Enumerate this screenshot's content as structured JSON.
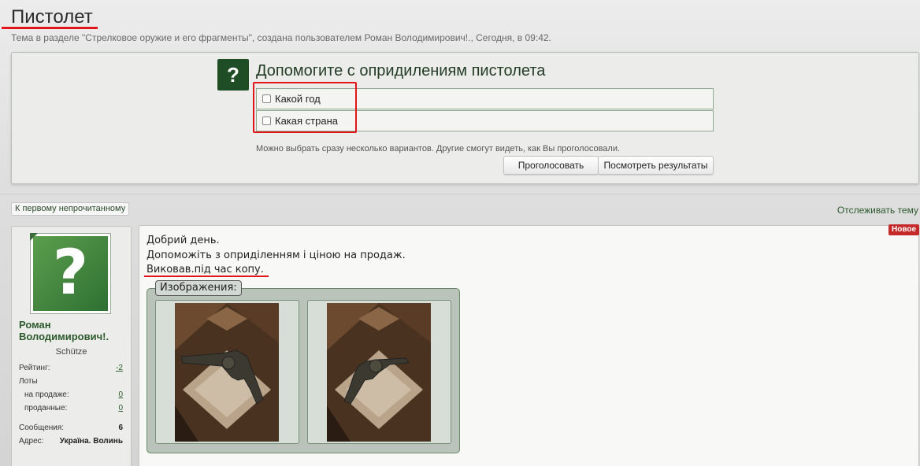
{
  "thread": {
    "title": "Пистолет",
    "meta": "Тема в разделе \"Стрелковое оружие и его фрагменты\", создана пользователем Роман Володимирович!., Сегодня, в 09:42."
  },
  "poll": {
    "question": "Допомогите с опридилениям пистолета",
    "options": [
      "Какой год",
      "Какая страна"
    ],
    "hint": "Можно выбрать сразу несколько вариантов. Другие смогут видеть, как Вы проголосовали.",
    "vote_label": "Проголосовать",
    "results_label": "Посмотреть результаты",
    "icon": "question-mark-icon"
  },
  "nav": {
    "first_unread": "К первому непрочитанному",
    "watch_thread": "Отслеживать тему"
  },
  "user": {
    "name": "Роман Володимирович!.",
    "title": "Schütze",
    "stats": {
      "rating_label": "Рейтинг:",
      "rating_value": "-2",
      "lots_label": "Лоты",
      "for_sale_label": "на продаже:",
      "for_sale_value": "0",
      "sold_label": "проданные:",
      "sold_value": "0",
      "messages_label": "Сообщения:",
      "messages_value": "6",
      "address_label": "Адрес:",
      "address_value": "Україна. Волинь"
    }
  },
  "post": {
    "badge": "Новое",
    "lines": [
      "Добрий день.",
      "Допоможіть з оприділенням і ціною на продаж.",
      "Виковав.під час копу."
    ],
    "images_label": "Изображения:"
  },
  "colors": {
    "accent_green": "#1f4d26",
    "link_green": "#2d5a2d",
    "highlight_red": "#e0161b",
    "badge_red": "#c52a2a"
  }
}
